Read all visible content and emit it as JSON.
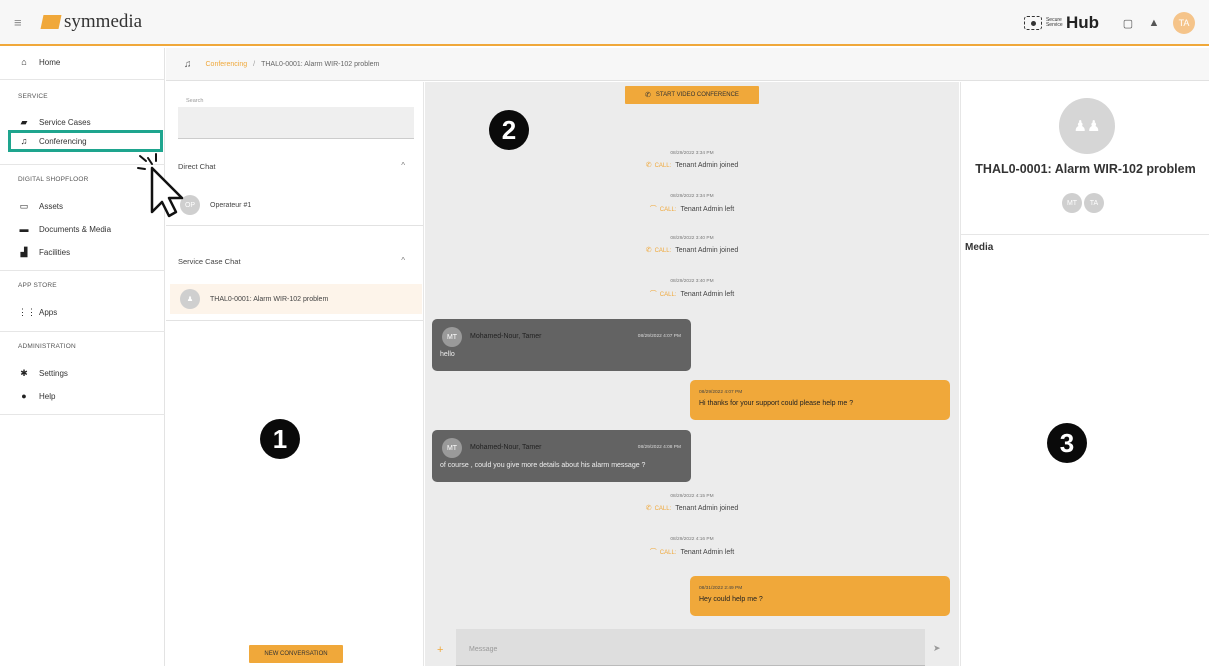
{
  "header": {
    "logo_text": "symmedia",
    "hub_small_label": "Secure Service",
    "hub_label": "Hub",
    "avatar_initials": "TA"
  },
  "sidebar": {
    "items": [
      {
        "icon": "home-icon",
        "glyph": "⌂",
        "label": "Home"
      },
      {
        "icon": "briefcase-icon",
        "glyph": "▰",
        "label": "Service Cases"
      },
      {
        "icon": "headset-icon",
        "glyph": "♫",
        "label": "Conferencing"
      },
      {
        "icon": "assets-icon",
        "glyph": "▭",
        "label": "Assets"
      },
      {
        "icon": "folder-icon",
        "glyph": "▬",
        "label": "Documents & Media"
      },
      {
        "icon": "factory-icon",
        "glyph": "▟",
        "label": "Facilities"
      },
      {
        "icon": "apps-icon",
        "glyph": "⋮⋮",
        "label": "Apps"
      },
      {
        "icon": "gear-icon",
        "glyph": "✱",
        "label": "Settings"
      },
      {
        "icon": "help-icon",
        "glyph": "●",
        "label": "Help"
      }
    ],
    "sections": {
      "service": "SERVICE",
      "digital_shopfloor": "DIGITAL SHOPFLOOR",
      "app_store": "APP STORE",
      "administration": "ADMINISTRATION"
    }
  },
  "breadcrumb": {
    "link": "Conferencing",
    "separator": "/",
    "current": "THAL0-0001: Alarm WIR-102 problem"
  },
  "conversations": {
    "search_label": "Search",
    "direct_chat_title": "Direct Chat",
    "direct_chats": [
      {
        "initials": "OP",
        "name": "Operateur #1"
      }
    ],
    "service_case_title": "Service Case Chat",
    "service_case_chats": [
      {
        "name": "THAL0-0001: Alarm WIR-102 problem"
      }
    ],
    "new_conversation_label": "NEW CONVERSATION"
  },
  "chat": {
    "video_button_label": "START VIDEO CONFERENCE",
    "call_label": "CALL:",
    "events": [
      {
        "time": "08/29/2022 3:34 PM",
        "type": "joined",
        "text": "Tenant Admin joined"
      },
      {
        "time": "08/29/2022 3:34 PM",
        "type": "left",
        "text": "Tenant Admin left"
      },
      {
        "time": "08/29/2022 3:40 PM",
        "type": "joined",
        "text": "Tenant Admin joined"
      },
      {
        "time": "08/29/2022 3:40 PM",
        "type": "left",
        "text": "Tenant Admin left"
      },
      {
        "time": "08/29/2022 4:15 PM",
        "type": "joined",
        "text": "Tenant Admin joined"
      },
      {
        "time": "08/29/2022 4:16 PM",
        "type": "left",
        "text": "Tenant Admin left"
      }
    ],
    "incoming": [
      {
        "initials": "MT",
        "name": "Mohamed-Nour, Tamer",
        "time": "08/29/2022 4:07 PM",
        "text": "hello"
      },
      {
        "initials": "MT",
        "name": "Mohamed-Nour, Tamer",
        "time": "08/29/2022 4:08 PM",
        "text": "of course , could you give more details about his alarm message ?"
      }
    ],
    "outgoing": [
      {
        "time": "08/29/2022 4:07 PM",
        "text": "Hi thanks for your support could please help me ?"
      },
      {
        "time": "08/31/2022 2:49 PM",
        "text": "Hey could help me ?"
      }
    ],
    "message_placeholder": "Message"
  },
  "details": {
    "title": "THAL0-0001: Alarm WIR-102 problem",
    "members": [
      "MT",
      "TA"
    ],
    "media_title": "Media"
  },
  "markers": [
    "1",
    "2",
    "3"
  ],
  "colors": {
    "accent": "#f0a83a",
    "highlight": "#1ea58e",
    "incoming_bubble": "#636363"
  }
}
